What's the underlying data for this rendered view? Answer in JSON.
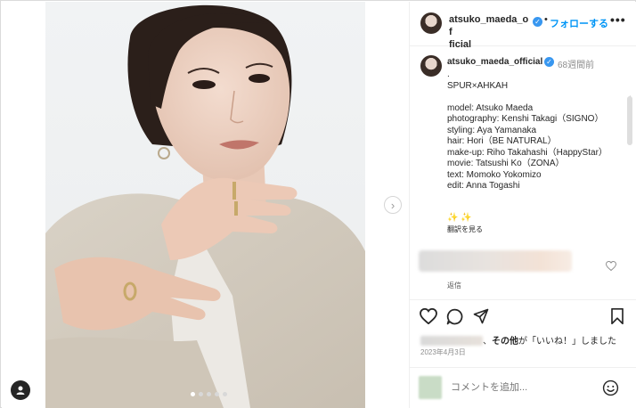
{
  "post": {
    "username": "atsuko_maeda_official",
    "header_username_line1": "atsuko_maeda_of",
    "header_username_line2": "ficial",
    "header_separator": "•",
    "follow_label": "フォローする",
    "more_label": "•••",
    "time_ago": "68週間前",
    "caption_lines": [
      ".",
      "SPUR×AHKAH",
      "",
      "model: Atsuko Maeda",
      "photography: Kenshi Takagi（SIGNO）",
      "styling: Aya Yamanaka",
      "hair: Hori（BE NATURAL）",
      "make-up: Riho Takahashi（HappyStar）",
      "movie: Tatsushi Ko（ZONA）",
      "text: Momoko Yokomizo",
      "edit: Anna Togashi"
    ],
    "sparkles": "✨ ✨",
    "translate_label": "翻訳を見る",
    "reply_label": "返信",
    "likes_suffix_bold": "その他",
    "likes_suffix": "が「いいね！」しました",
    "likes_prefix": "、",
    "date": "2023年4月3日",
    "comment_placeholder": "コメントを追加...",
    "carousel": {
      "slide_count": 5,
      "active_index": 0
    }
  },
  "icons": {
    "heart": "heart-icon",
    "comment": "comment-icon",
    "share": "send-icon",
    "save": "bookmark-icon",
    "emoji": "emoji-icon",
    "next": "chevron-right-icon",
    "user_tag": "user-tag-icon",
    "verified": "verified-badge-icon"
  },
  "colors": {
    "accent": "#0095f6",
    "verified": "#3897f0",
    "text": "#262626",
    "muted": "#8e8e8e"
  }
}
